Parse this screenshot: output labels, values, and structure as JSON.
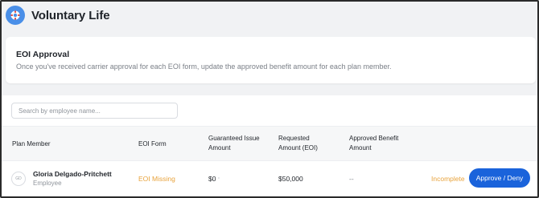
{
  "header": {
    "title": "Voluntary Life",
    "icon": "life-preserver-icon"
  },
  "card": {
    "title": "EOI Approval",
    "description": "Once you've received carrier approval for each EOI form, update the approved benefit amount for each plan member."
  },
  "search": {
    "placeholder": "Search by employee name..."
  },
  "table": {
    "columns": [
      "Plan Member",
      "EOI Form",
      "Guaranteed Issue Amount",
      "Requested Amount (EOI)",
      "Approved Benefit Amount"
    ],
    "rows": [
      {
        "initials": "GD",
        "name": "Gloria Delgado-Pritchett",
        "role": "Employee",
        "eoi_form": "EOI Missing",
        "guaranteed": "$0",
        "requested": "$50,000",
        "approved": "--",
        "status": "Incomplete",
        "action": "Approve / Deny"
      }
    ]
  },
  "colors": {
    "accent": "#1a63db",
    "warning": "#e8a33d",
    "icon_bg": "#4a8fe8"
  }
}
